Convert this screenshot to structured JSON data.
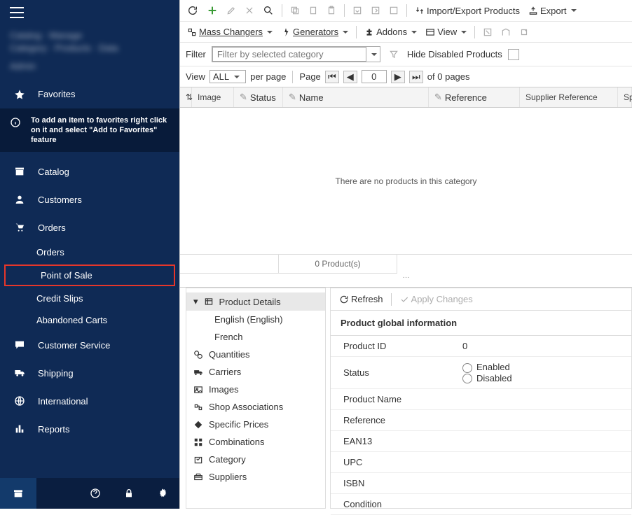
{
  "sidebar": {
    "blur_lines": [
      "Catalog · Manage",
      "Category · Products · Data",
      "Admin"
    ],
    "favorites": "Favorites",
    "fav_tip": "To add an item to favorites right click on it and select \"Add to Favorites\" feature",
    "catalog": "Catalog",
    "customers": "Customers",
    "orders": "Orders",
    "orders_sub": {
      "orders": "Orders",
      "pos": "Point of Sale",
      "credit": "Credit Slips",
      "aband": "Abandoned Carts"
    },
    "cs": "Customer Service",
    "shipping": "Shipping",
    "intl": "International",
    "reports": "Reports"
  },
  "toolbar": {
    "import": "Import/Export Products",
    "export": "Export",
    "mass": "Mass Changers",
    "gen": "Generators",
    "addons": "Addons",
    "view": "View"
  },
  "filter": {
    "label": "Filter",
    "placeholder": "Filter by selected category",
    "hide": "Hide Disabled Products"
  },
  "pager": {
    "view": "View",
    "all": "ALL",
    "pp": "per page",
    "page": "Page",
    "pn": "0",
    "of": "of 0 pages"
  },
  "cols": {
    "image": "Image",
    "status": "Status",
    "name": "Name",
    "ref": "Reference",
    "sref": "Supplier Reference",
    "sp": "Sp"
  },
  "empty": "There are no products in this category",
  "count": "0 Product(s)",
  "tree": {
    "pd": "Product Details",
    "en": "English (English)",
    "fr": "French",
    "qty": "Quantities",
    "car": "Carriers",
    "img": "Images",
    "shop": "Shop Associations",
    "price": "Specific Prices",
    "comb": "Combinations",
    "cat": "Category",
    "sup": "Suppliers"
  },
  "detail": {
    "refresh": "Refresh",
    "apply": "Apply Changes",
    "title": "Product global information",
    "pid": "Product ID",
    "pid_v": "0",
    "status": "Status",
    "en": "Enabled",
    "dis": "Disabled",
    "pname": "Product Name",
    "ref": "Reference",
    "ean": "EAN13",
    "upc": "UPC",
    "isbn": "ISBN",
    "cond": "Condition"
  }
}
